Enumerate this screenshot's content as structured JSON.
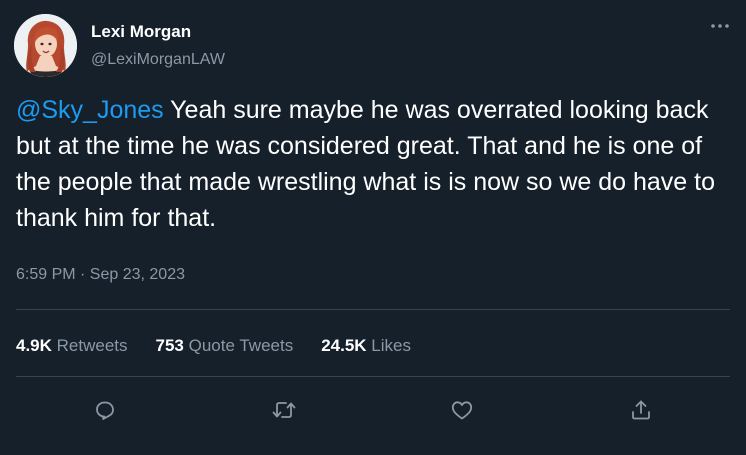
{
  "author": {
    "display_name": "Lexi Morgan",
    "handle": "@LexiMorganLAW"
  },
  "tweet": {
    "mention": "@Sky_Jones",
    "text": " Yeah sure maybe he was overrated looking back but at the time he was considered great. That and he is one of the people that made wrestling what is is now so we do have to thank him for that.",
    "timestamp": "6:59 PM · Sep 23, 2023"
  },
  "stats": {
    "retweets_count": "4.9K",
    "retweets_label": " Retweets",
    "quotes_count": "753",
    "quotes_label": " Quote Tweets",
    "likes_count": "24.5K",
    "likes_label": " Likes"
  },
  "icons": {
    "more": "more-horizontal-icon",
    "reply": "reply-icon",
    "retweet": "retweet-icon",
    "like": "heart-icon",
    "share": "share-icon"
  },
  "colors": {
    "background": "#15202b",
    "accent": "#1d9bf0",
    "secondary_text": "#8b98a5",
    "divider": "#38444d"
  }
}
